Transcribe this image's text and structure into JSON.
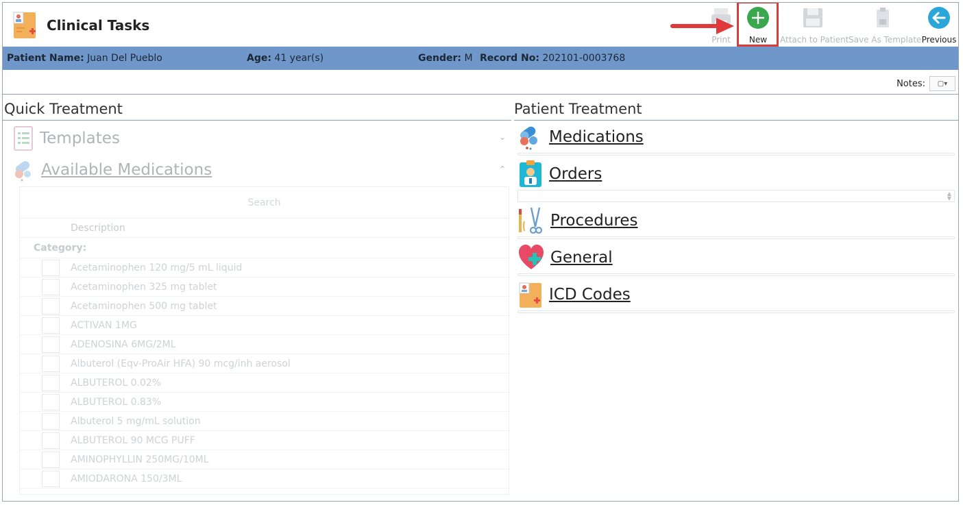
{
  "app": {
    "title": "Clinical Tasks",
    "logo_icon": "medical-record-icon"
  },
  "toolbar": {
    "print": {
      "label": "Print",
      "icon": "printer-icon",
      "enabled": false
    },
    "new": {
      "label": "New",
      "icon": "plus-circle-icon",
      "enabled": true,
      "color": "#3aa64e"
    },
    "attach": {
      "label": "Attach to Patient",
      "icon": "save-disk-icon",
      "enabled": false
    },
    "template": {
      "label": "Save As Template",
      "icon": "clipboard-save-icon",
      "enabled": false
    },
    "previous": {
      "label": "Previous",
      "icon": "arrow-left-circle-icon",
      "enabled": true,
      "color": "#2aa6d9"
    },
    "highlight_color": "#e0393a"
  },
  "patient": {
    "name_label": "Patient Name:",
    "name": "Juan Del Pueblo",
    "age_label": "Age:",
    "age": "41 year(s)",
    "gender_label": "Gender:",
    "gender": "M",
    "record_label": "Record No:",
    "record": "202101-0003768",
    "bar_color": "#6f97c9"
  },
  "notes": {
    "label": "Notes:"
  },
  "quick_treatment": {
    "heading": "Quick Treatment",
    "templates_label": "Templates",
    "available_label": "Available Medications",
    "search_placeholder": "Search",
    "column_description": "Description",
    "category_label": "Category:",
    "medications": [
      "Acetaminophen 120 mg/5 mL liquid",
      "Acetaminophen 325 mg tablet",
      "Acetaminophen 500 mg tablet",
      "ACTIVAN 1MG",
      "ADENOSINA 6MG/2ML",
      "Albuterol (Eqv-ProAir HFA) 90 mcg/inh aerosol",
      "ALBUTEROL 0.02%",
      "ALBUTEROL 0.83%",
      "Albuterol 5 mg/mL solution",
      "ALBUTEROL 90 MCG PUFF",
      "AMINOPHYLLIN 250MG/10ML",
      "AMIODARONA 150/3ML"
    ]
  },
  "patient_treatment": {
    "heading": "Patient Treatment",
    "medications": "Medications",
    "orders": "Orders",
    "procedures": "Procedures",
    "general": "General",
    "icd_codes": "ICD Codes"
  }
}
